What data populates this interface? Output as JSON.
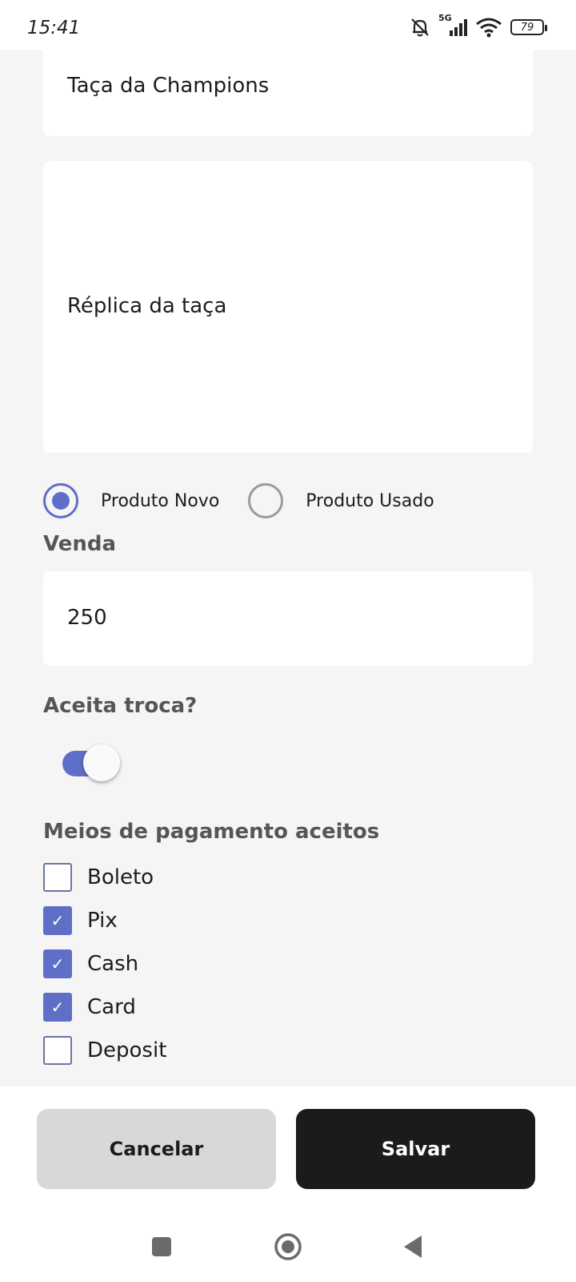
{
  "status_bar": {
    "time": "15:41",
    "network": "5G",
    "battery": "79",
    "icons": [
      "bell-muted-icon",
      "signal-icon",
      "wifi-icon",
      "battery-icon"
    ]
  },
  "form": {
    "title_value": "Taça da Champions",
    "description_value": "Réplica da taça",
    "condition_options": [
      {
        "label": "Produto Novo",
        "selected": true
      },
      {
        "label": "Produto Usado",
        "selected": false
      }
    ],
    "price_label": "Venda",
    "price_value": "250",
    "trade_label": "Aceita troca?",
    "trade_enabled": true,
    "payment_label": "Meios de pagamento aceitos",
    "payment_methods": [
      {
        "label": "Boleto",
        "checked": false
      },
      {
        "label": "Pix",
        "checked": true
      },
      {
        "label": "Cash",
        "checked": true
      },
      {
        "label": "Card",
        "checked": true
      },
      {
        "label": "Deposit",
        "checked": false
      }
    ]
  },
  "actions": {
    "cancel_label": "Cancelar",
    "save_label": "Salvar"
  },
  "colors": {
    "accent": "#5f6fc7",
    "primary_button": "#1b1b1d",
    "secondary_button": "#d8d8da",
    "background": "#f5f5f6"
  }
}
